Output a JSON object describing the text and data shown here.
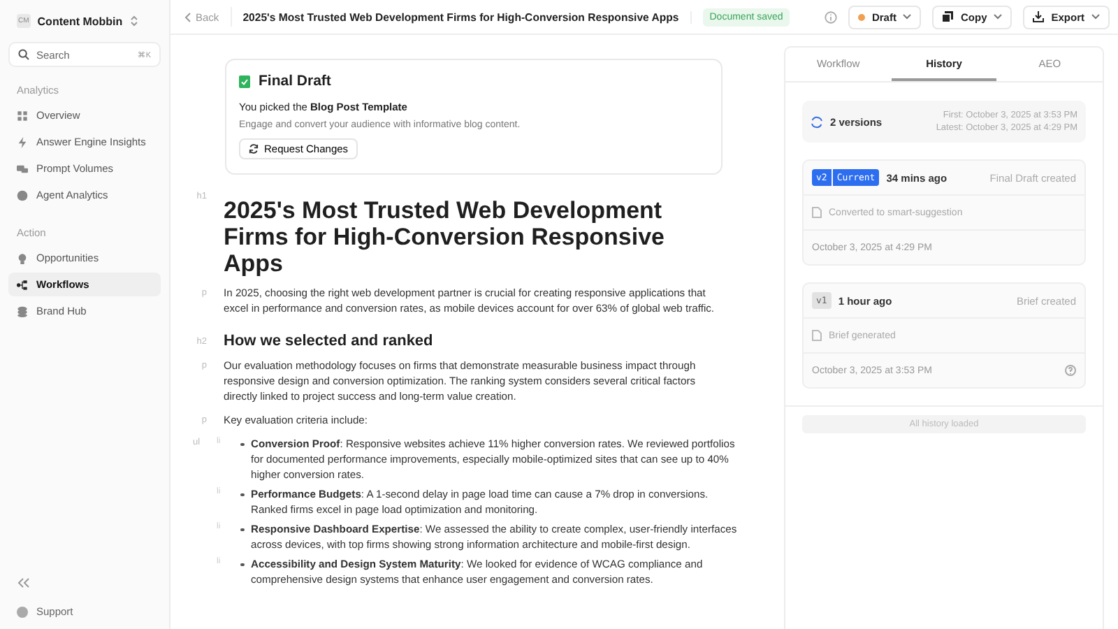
{
  "workspace": {
    "initials": "CM",
    "name": "Content Mobbin"
  },
  "search": {
    "placeholder": "Search",
    "shortcut": "⌘K"
  },
  "sidebar": {
    "sections": [
      {
        "title": "Analytics",
        "items": [
          {
            "label": "Overview",
            "selected": false
          },
          {
            "label": "Answer Engine Insights",
            "selected": false
          },
          {
            "label": "Prompt Volumes",
            "selected": false
          },
          {
            "label": "Agent Analytics",
            "selected": false
          }
        ]
      },
      {
        "title": "Action",
        "items": [
          {
            "label": "Opportunities",
            "selected": false
          },
          {
            "label": "Workflows",
            "selected": true
          },
          {
            "label": "Brand Hub",
            "selected": false
          }
        ]
      }
    ],
    "support": "Support"
  },
  "topbar": {
    "back": "Back",
    "title": "2025's Most Trusted Web Development Firms for High-Conversion Responsive Apps",
    "status": "Document saved",
    "draft": "Draft",
    "copy": "Copy",
    "export": "Export"
  },
  "template_card": {
    "title": "Final Draft",
    "picked": "You picked the **Blog Post Template**",
    "description": "Engage and convert your audience with informative blog content.",
    "button": "Request Changes"
  },
  "blocks": [
    {
      "kind": "h1",
      "tag": "h1",
      "text": "2025's Most Trusted Web Development Firms for High-Conversion Responsive Apps"
    },
    {
      "kind": "p",
      "tag": "p",
      "text": "In 2025, choosing the right web development partner is crucial for creating responsive applications that excel in performance and conversion rates, as mobile devices account for over 63% of global web traffic."
    },
    {
      "kind": "h2",
      "tag": "h2",
      "text": "How we selected and ranked"
    },
    {
      "kind": "p",
      "tag": "p",
      "text": "Our evaluation methodology focuses on firms that demonstrate measurable business impact through responsive design and conversion optimization. The ranking system considers several critical factors directly linked to project success and long-term value creation."
    },
    {
      "kind": "p",
      "tag": "p",
      "text": "Key evaluation criteria include:"
    },
    {
      "kind": "ul",
      "tag": "ul",
      "items": [
        {
          "tag": "li",
          "text": "**Conversion Proof**: Responsive websites achieve 11% higher conversion rates. We reviewed portfolios for documented performance improvements, especially mobile-optimized sites that can see up to 40% higher conversion rates."
        },
        {
          "tag": "li",
          "text": "**Performance Budgets**: A 1-second delay in page load time can cause a 7% drop in conversions. Ranked firms excel in page load optimization and monitoring."
        },
        {
          "tag": "li",
          "text": "**Responsive Dashboard Expertise**: We assessed the ability to create complex, user-friendly interfaces across devices, with top firms showing strong information architecture and mobile-first design."
        },
        {
          "tag": "li",
          "text": "**Accessibility and Design System Maturity**: We looked for evidence of WCAG compliance and comprehensive design systems that enhance user engagement and conversion rates."
        }
      ]
    }
  ],
  "panel": {
    "tabs": [
      {
        "label": "Workflow",
        "selected": false
      },
      {
        "label": "History",
        "selected": true
      },
      {
        "label": "AEO",
        "selected": false
      }
    ],
    "summary": {
      "count": "2 versions",
      "first": "First: October 3, 2025 at 3:53 PM",
      "latest": "Latest: October 3, 2025 at 4:29 PM"
    },
    "versions": [
      {
        "version": "v2",
        "badge": "Current",
        "current": true,
        "ago": "34 mins ago",
        "event": "Final Draft created",
        "note": "Converted to smart-suggestion",
        "date": "October 3, 2025 at 4:29 PM"
      },
      {
        "version": "v1",
        "current": false,
        "ago": "1 hour ago",
        "event": "Brief created",
        "note": "Brief generated",
        "date": "October 3, 2025 at 3:53 PM"
      }
    ],
    "footer": "All history loaded"
  }
}
